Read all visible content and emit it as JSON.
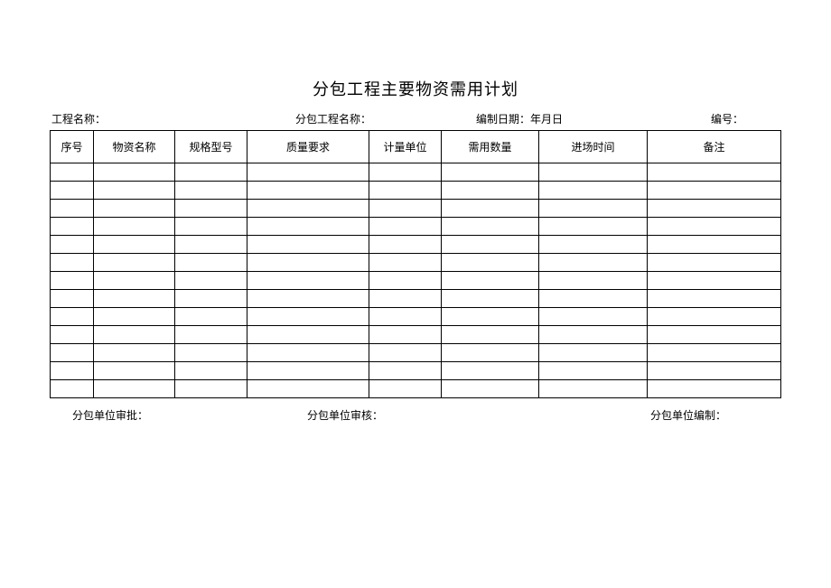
{
  "title": "分包工程主要物资需用计划",
  "meta": {
    "project_label": "工程名称：",
    "sub_project_label": "分包工程名称：",
    "date_label": "编制日期：年月日",
    "number_label": "编号："
  },
  "headers": {
    "seq": "序号",
    "name": "物资名称",
    "spec": "规格型号",
    "quality": "质量要求",
    "unit": "计量单位",
    "qty": "需用数量",
    "time": "进场时间",
    "remark": "备注"
  },
  "rows": [
    {
      "seq": "",
      "name": "",
      "spec": "",
      "quality": "",
      "unit": "",
      "qty": "",
      "time": "",
      "remark": ""
    },
    {
      "seq": "",
      "name": "",
      "spec": "",
      "quality": "",
      "unit": "",
      "qty": "",
      "time": "",
      "remark": ""
    },
    {
      "seq": "",
      "name": "",
      "spec": "",
      "quality": "",
      "unit": "",
      "qty": "",
      "time": "",
      "remark": ""
    },
    {
      "seq": "",
      "name": "",
      "spec": "",
      "quality": "",
      "unit": "",
      "qty": "",
      "time": "",
      "remark": ""
    },
    {
      "seq": "",
      "name": "",
      "spec": "",
      "quality": "",
      "unit": "",
      "qty": "",
      "time": "",
      "remark": ""
    },
    {
      "seq": "",
      "name": "",
      "spec": "",
      "quality": "",
      "unit": "",
      "qty": "",
      "time": "",
      "remark": ""
    },
    {
      "seq": "",
      "name": "",
      "spec": "",
      "quality": "",
      "unit": "",
      "qty": "",
      "time": "",
      "remark": ""
    },
    {
      "seq": "",
      "name": "",
      "spec": "",
      "quality": "",
      "unit": "",
      "qty": "",
      "time": "",
      "remark": ""
    },
    {
      "seq": "",
      "name": "",
      "spec": "",
      "quality": "",
      "unit": "",
      "qty": "",
      "time": "",
      "remark": ""
    },
    {
      "seq": "",
      "name": "",
      "spec": "",
      "quality": "",
      "unit": "",
      "qty": "",
      "time": "",
      "remark": ""
    },
    {
      "seq": "",
      "name": "",
      "spec": "",
      "quality": "",
      "unit": "",
      "qty": "",
      "time": "",
      "remark": ""
    },
    {
      "seq": "",
      "name": "",
      "spec": "",
      "quality": "",
      "unit": "",
      "qty": "",
      "time": "",
      "remark": ""
    },
    {
      "seq": "",
      "name": "",
      "spec": "",
      "quality": "",
      "unit": "",
      "qty": "",
      "time": "",
      "remark": ""
    }
  ],
  "footer": {
    "approve": "分包单位审批：",
    "review": "分包单位审核：",
    "compile": "分包单位编制："
  }
}
